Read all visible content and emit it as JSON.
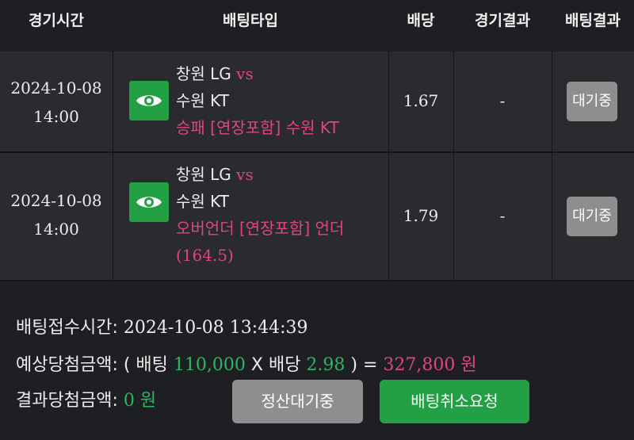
{
  "headers": {
    "time": "경기시간",
    "type": "배팅타입",
    "odds": "배당",
    "game_result": "경기결과",
    "bet_result": "배팅결과"
  },
  "rows": [
    {
      "date": "2024-10-08",
      "time": "14:00",
      "home": "창원 LG",
      "vs": "vs",
      "away": "수원 KT",
      "pick_line1": "승패 [연장포함] 수원 KT",
      "pick_line2": "",
      "odds": "1.67",
      "game_result": "-",
      "bet_result": "대기중"
    },
    {
      "date": "2024-10-08",
      "time": "14:00",
      "home": "창원 LG",
      "vs": "vs",
      "away": "수원 KT",
      "pick_line1": "오버언더 [연장포함] 언더",
      "pick_line2": "(164.5)",
      "odds": "1.79",
      "game_result": "-",
      "bet_result": "대기중"
    }
  ],
  "summary": {
    "received_label": "배팅접수시간: ",
    "received_value": "2024-10-08 13:44:39",
    "expected_label": "예상당첨금액: ( 배팅 ",
    "stake": "110,000",
    "x_label": " X 배당 ",
    "total_odds": "2.98",
    "equals": " ) = ",
    "expected_amount": "327,800 원",
    "result_label": "결과당첨금액: ",
    "result_amount": "0 원"
  },
  "buttons": {
    "settle_wait": "정산대기중",
    "cancel_request": "배팅취소요청"
  },
  "colors": {
    "accent_green": "#22a043",
    "accent_pink": "#e0457b",
    "text_green": "#2db562",
    "button_gray": "#8e8e8e"
  },
  "icons": {
    "view": "eye-icon"
  }
}
